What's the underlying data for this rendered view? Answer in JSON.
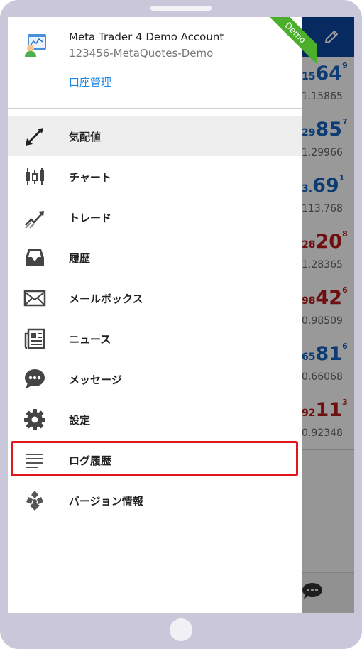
{
  "account": {
    "title": "Meta Trader 4 Demo Account",
    "server": "123456-MetaQuotes-Demo",
    "manage_label": "口座管理",
    "badge": "Demo"
  },
  "menu": [
    {
      "label": "気配値",
      "icon": "arrows-icon",
      "active": true
    },
    {
      "label": "チャート",
      "icon": "candlestick-icon"
    },
    {
      "label": "トレード",
      "icon": "trend-icon"
    },
    {
      "label": "履歴",
      "icon": "inbox-icon"
    },
    {
      "label": "メールボックス",
      "icon": "mail-icon"
    },
    {
      "label": "ニュース",
      "icon": "news-icon"
    },
    {
      "label": "メッセージ",
      "icon": "chat-icon"
    },
    {
      "label": "設定",
      "icon": "gear-icon"
    },
    {
      "label": "ログ履歴",
      "icon": "list-icon",
      "highlighted": true
    },
    {
      "label": "バージョン情報",
      "icon": "about-icon"
    }
  ],
  "quotes": [
    {
      "small": "15",
      "big": "64",
      "sup": "9",
      "price": "1.15865",
      "color": "blue"
    },
    {
      "small": "29",
      "big": "85",
      "sup": "7",
      "price": "1.29966",
      "color": "blue"
    },
    {
      "small": "3.",
      "big": "69",
      "sup": "1",
      "price": "113.768",
      "color": "blue"
    },
    {
      "small": "28",
      "big": "20",
      "sup": "8",
      "price": "1.28365",
      "color": "red"
    },
    {
      "small": "98",
      "big": "42",
      "sup": "6",
      "price": "0.98509",
      "color": "red"
    },
    {
      "small": "65",
      "big": "81",
      "sup": "6",
      "price": "0.66068",
      "color": "blue"
    },
    {
      "small": "92",
      "big": "11",
      "sup": "3",
      "price": "0.92348",
      "color": "red"
    }
  ],
  "colors": {
    "header": "#0d47a1",
    "ribbon": "#4caf2c",
    "link": "#1e88e5",
    "highlight": "#e0161a",
    "bid_up": "#1565c0",
    "bid_down": "#b71c1c"
  }
}
